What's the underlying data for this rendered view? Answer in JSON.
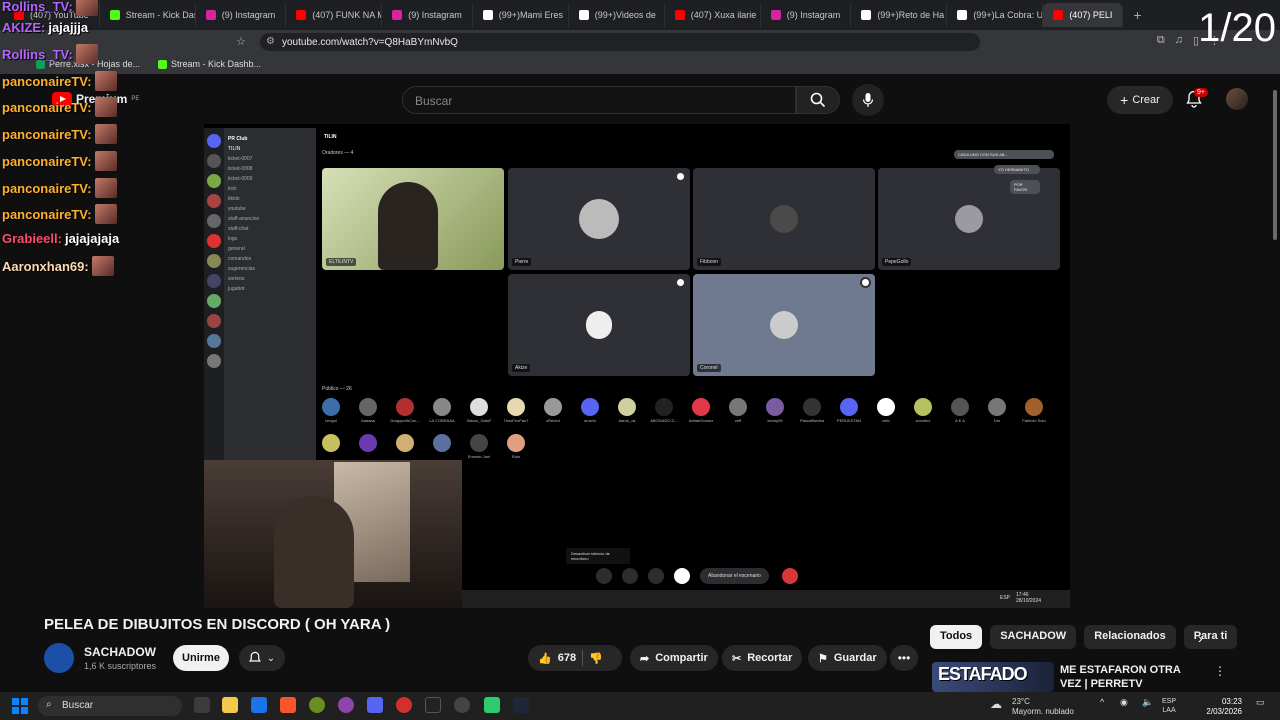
{
  "browser": {
    "tabs": [
      {
        "label": "(407) YouTube",
        "color": "#ff0000"
      },
      {
        "label": "Stream - Kick Das",
        "color": "#53fc18"
      },
      {
        "label": "(9) Instagram",
        "color": "#d6249f"
      },
      {
        "label": "(407) FUNK NA M",
        "color": "#ff0000"
      },
      {
        "label": "(9) Instagram",
        "color": "#d6249f"
      },
      {
        "label": "(99+)Mami Eres",
        "color": "#ffffff"
      },
      {
        "label": "(99+)Videos de",
        "color": "#ffffff"
      },
      {
        "label": "(407) Xuxa ilarie",
        "color": "#ff0000"
      },
      {
        "label": "(9) Instagram",
        "color": "#d6249f"
      },
      {
        "label": "(99+)Reto de Ha",
        "color": "#ffffff"
      },
      {
        "label": "(99+)La Cobra: U",
        "color": "#ffffff"
      },
      {
        "label": "(407) PELI",
        "color": "#ff0000",
        "active": true
      }
    ],
    "url": "youtube.com/watch?v=Q8HaBYmNvbQ",
    "bookmarks": [
      "Perre.xlsx - Hojas de...",
      "Stream - Kick Dashb..."
    ]
  },
  "youtube": {
    "logo_text": "Premium",
    "logo_region": "PE",
    "search_placeholder": "Buscar",
    "create_label": "Crear",
    "notifications": "9+"
  },
  "chat_overlay": {
    "counter": "1/20",
    "messages": [
      {
        "user": "Rollins_TV:",
        "text": "",
        "color": "#b565ff"
      },
      {
        "user": "AKIZE:",
        "text": "jajajjja",
        "color": "#b565ff"
      },
      {
        "user": "Rollins_TV:",
        "text": "",
        "color": "#b565ff"
      },
      {
        "user": "panconaireTV:",
        "text": "",
        "color": "#ffb02e"
      },
      {
        "user": "panconaireTV:",
        "text": "",
        "color": "#ffb02e"
      },
      {
        "user": "panconaireTV:",
        "text": "",
        "color": "#ffb02e"
      },
      {
        "user": "panconaireTV:",
        "text": "",
        "color": "#ffb02e"
      },
      {
        "user": "panconaireTV:",
        "text": "",
        "color": "#ffb02e"
      },
      {
        "user": "panconaireTV:",
        "text": "",
        "color": "#ffb02e"
      },
      {
        "user": "Grabieell:",
        "text": "jajajajaja",
        "color": "#ff4d6d"
      },
      {
        "user": "Aaronxhan69:",
        "text": "",
        "color": "#ffd9b3"
      }
    ]
  },
  "discord": {
    "server": "PR Club",
    "channel": "TILIN",
    "speakers_label": "Oradores — 4",
    "audience_label": "Público — 26",
    "tiles": [
      "ELTILINTV",
      "Pierre",
      "Fibboon",
      "PepeGollo",
      "Akize",
      "Coronel"
    ],
    "channels": [
      "ticket-0007",
      "ticket-0008",
      "ticket-0009",
      "kick",
      "tiktok",
      "youtube",
      "staff-anuncios",
      "staff-chat",
      "logs",
      "general",
      "comandos",
      "sugerencias",
      "sorteos",
      "jugabot"
    ],
    "chat_bubbles": [
      "CADA UNO CON SUS AB...",
      "YO HERMANITO",
      "POR FAVOR"
    ],
    "audience": [
      "Izmgol",
      "Aaaaaa",
      "DragopothCon...",
      "LA COBRAAA",
      "Satoru_GatoF",
      "TimoFeoPao7",
      "zRelord",
      "arrorto",
      "Aaron_ok",
      "ABOGADO D...",
      "AdrianGomez",
      "zeff",
      "kenny05",
      "PancaBomba",
      "PERUKSTAN",
      "veto",
      "snowfox",
      "A E A",
      "Dm",
      "Fabricio Soto",
      "",
      "",
      "",
      "",
      "Ernesto Joel",
      "Ruin"
    ],
    "tooltip": "Desactivar silencio de micrófono",
    "leave_label": "Abandonar el escenario",
    "taskbar_time": "17:46",
    "taskbar_date": "28/10/2024",
    "taskbar_lang": "ESP"
  },
  "video": {
    "title": "PELEA DE DIBUJITOS EN DISCORD ( OH YARA )",
    "channel": "SACHADOW",
    "subscribers": "1,6 K suscriptores",
    "join_label": "Unirme",
    "likes": "678",
    "share_label": "Compartir",
    "clip_label": "Recortar",
    "save_label": "Guardar"
  },
  "sidebar": {
    "chips": [
      "Todos",
      "SACHADOW",
      "Relacionados",
      "Para ti"
    ],
    "recommendation_title": "ME ESTAFARON OTRA VEZ | PERRETV",
    "recommendation_thumb_text": "ESTAFADO"
  },
  "taskbar": {
    "search_label": "Buscar",
    "weather_temp": "23°C",
    "weather_desc": "Mayorm. nublado",
    "lang_top": "ESP",
    "lang_bottom": "LAA",
    "time": "03:23",
    "date": "2/03/2026"
  }
}
